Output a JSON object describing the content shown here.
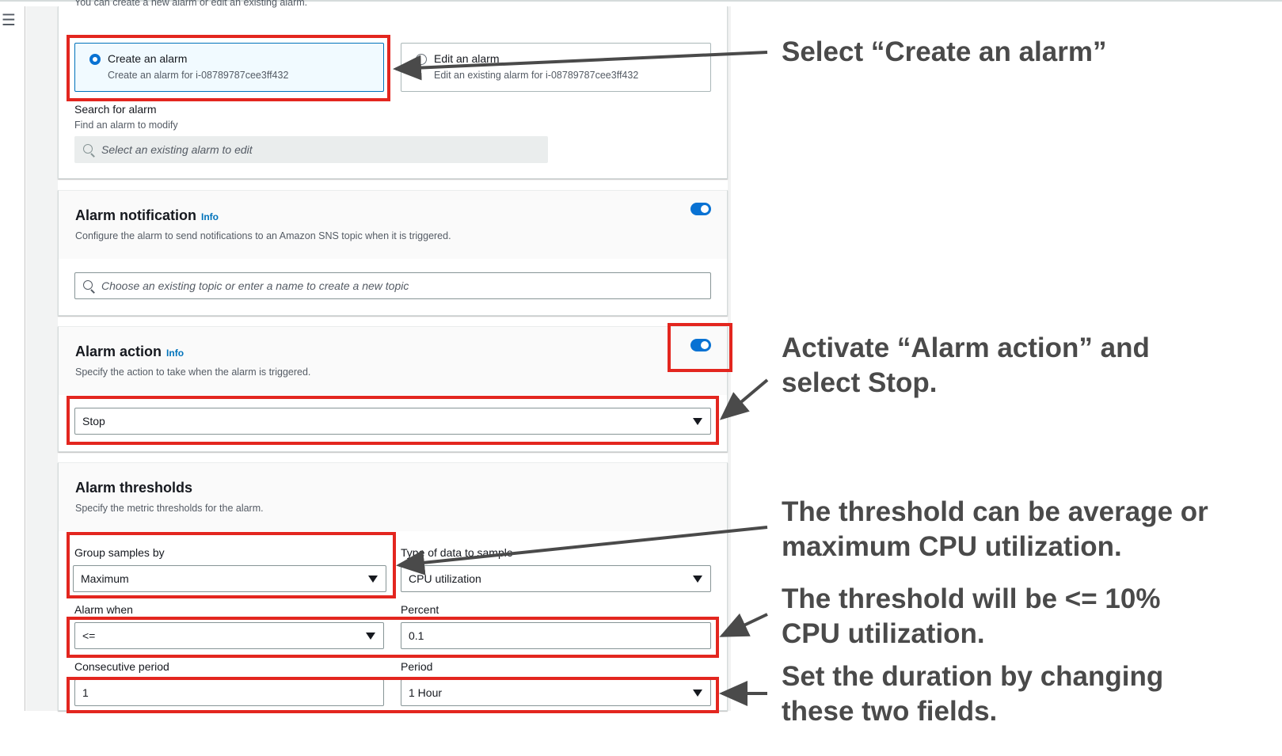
{
  "sections": {
    "intro_truncated": "You can create a new alarm or edit an existing alarm.",
    "alarm_choice": {
      "create": {
        "label": "Create an alarm",
        "description": "Create an alarm for i-08789787cee3ff432",
        "selected": true
      },
      "edit": {
        "label": "Edit an alarm",
        "description": "Edit an existing alarm for i-08789787cee3ff432",
        "selected": false
      }
    },
    "search_alarm": {
      "label": "Search for alarm",
      "description": "Find an alarm to modify",
      "placeholder": "Select an existing alarm to edit"
    },
    "alarm_notification": {
      "title": "Alarm notification",
      "info": "Info",
      "description": "Configure the alarm to send notifications to an Amazon SNS topic when it is triggered.",
      "enabled": true,
      "topic_placeholder": "Choose an existing topic or enter a name to create a new topic"
    },
    "alarm_action": {
      "title": "Alarm action",
      "info": "Info",
      "description": "Specify the action to take when the alarm is triggered.",
      "enabled": true,
      "selected_action": "Stop"
    },
    "alarm_thresholds": {
      "title": "Alarm thresholds",
      "description": "Specify the metric thresholds for the alarm.",
      "group_samples_label": "Group samples by",
      "group_samples_value": "Maximum",
      "data_type_label": "Type of data to sample",
      "data_type_value": "CPU utilization",
      "alarm_when_label": "Alarm when",
      "alarm_when_value": "<=",
      "percent_label": "Percent",
      "percent_value": "0.1",
      "consecutive_label": "Consecutive period",
      "consecutive_value": "1",
      "period_label": "Period",
      "period_value": "1 Hour"
    }
  },
  "annotations": {
    "create_alarm": "Select “Create an alarm”",
    "alarm_action_line1": "Activate “Alarm action” and",
    "alarm_action_line2": "select Stop.",
    "threshold_line1": "The threshold can be average or",
    "threshold_line2": "maximum CPU utilization.",
    "threshold_value_line1": "The threshold will be <= 10%",
    "threshold_value_line2": "CPU utilization.",
    "duration_line1": "Set the duration by changing",
    "duration_line2": "these two fields."
  },
  "colors": {
    "highlight": "#e3261f",
    "toggle_on": "#0972d3",
    "annotation_text": "#4a4a4a"
  },
  "icons": [
    "menu-icon",
    "search-icon",
    "caret-down-icon",
    "radio-icon",
    "toggle-switch"
  ]
}
